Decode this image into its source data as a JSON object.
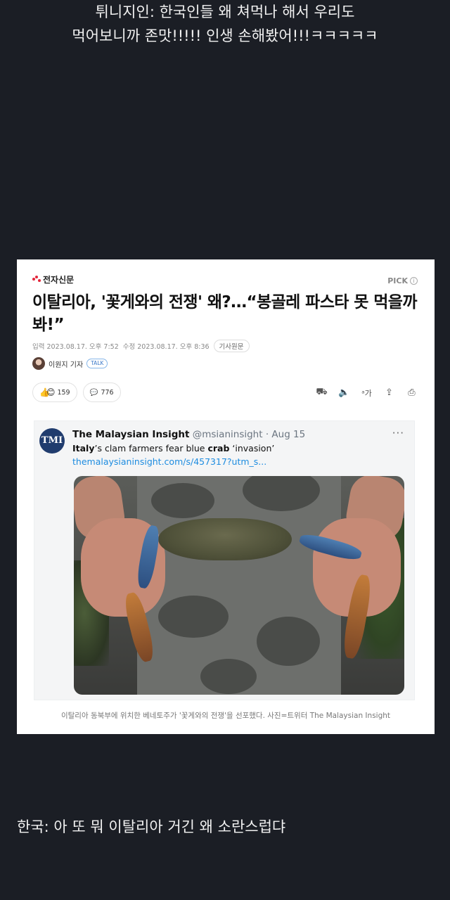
{
  "caption_top": {
    "line1": "튀니지인: 한국인들 왜 쳐먹나 해서 우리도",
    "line2": "먹어보니까 존맛!!!!! 인생 손해봤어!!!ㅋㅋㅋㅋㅋ"
  },
  "article": {
    "brand": "전자신문",
    "pick_label": "PICK",
    "headline": "이탈리아, '꽃게와의 전쟁' 왜?…“봉골레 파스타 못 먹을까 봐!”",
    "input_time": "입력 2023.08.17. 오후 7:52",
    "edit_time": "수정 2023.08.17. 오후 8:36",
    "original_button": "기사원문",
    "reporter": "이원지 기자",
    "talk_label": "TALK",
    "reaction_count": "159",
    "comment_count": "776",
    "font_size_icon_label": "가"
  },
  "tweet": {
    "avatar_text": "TMI",
    "name": "The Malaysian Insight",
    "handle": "@msianinsight · Aug 15",
    "more": "···",
    "text_part1": "Italy",
    "text_part2": "’s clam farmers fear blue ",
    "text_part3": "crab",
    "text_part4": " ‘invasion’",
    "link": "themalaysianinsight.com/s/457317?utm_s..."
  },
  "photo_caption": "이탈리아 동북부에 위치한 베네토주가 '꽃게와의 전쟁'을 선포했다. 사진=트위터 The Malaysian Insight",
  "caption_bottom": "한국: 아 또 뭐 이탈리아 거긴 왜 소란스럽댜",
  "icons": [
    "smile-icon",
    "comment-icon",
    "scooter-icon",
    "speaker-icon",
    "font-size-icon",
    "share-icon",
    "print-icon",
    "info-icon",
    "more-icon"
  ],
  "colors": {
    "background": "#1b1e25",
    "brand_red": "#e3263b",
    "link_blue": "#1d8ce0"
  }
}
